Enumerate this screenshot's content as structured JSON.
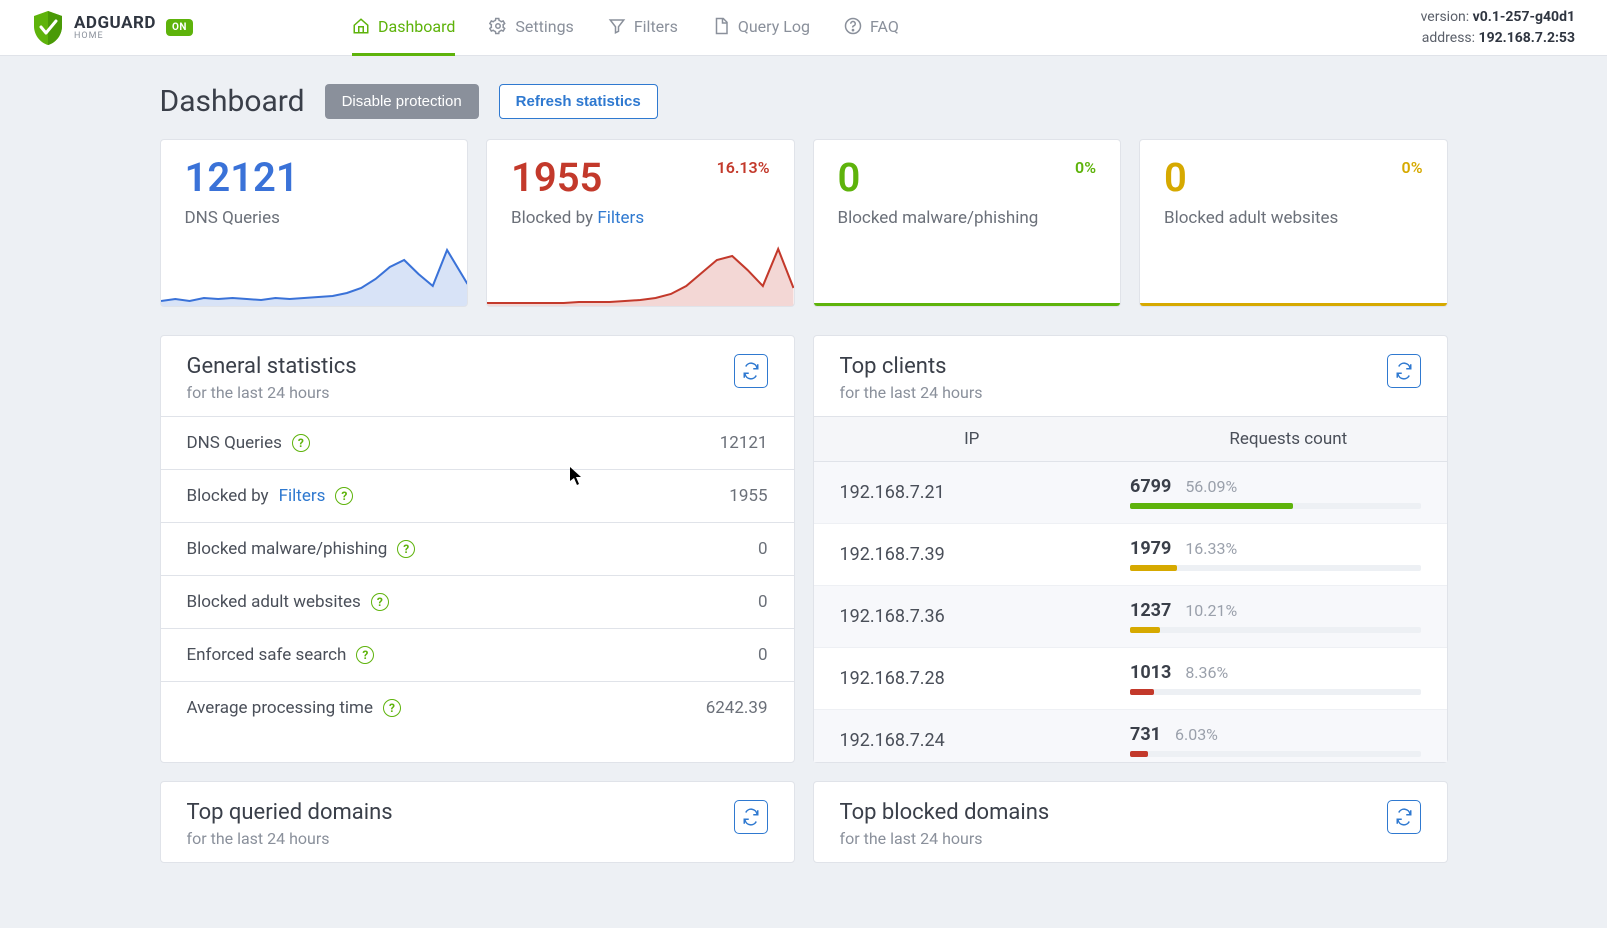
{
  "brand": {
    "name": "ADGUARD",
    "sub": "HOME",
    "status_badge": "ON"
  },
  "nav": {
    "items": [
      {
        "label": "Dashboard",
        "icon": "home-icon",
        "active": true
      },
      {
        "label": "Settings",
        "icon": "gear-icon"
      },
      {
        "label": "Filters",
        "icon": "funnel-icon"
      },
      {
        "label": "Query Log",
        "icon": "doc-icon"
      },
      {
        "label": "FAQ",
        "icon": "help-icon"
      }
    ],
    "version_label": "version:",
    "version_value": "v0.1-257-g40d1",
    "address_label": "address:",
    "address_value": "192.168.7.2:53"
  },
  "header": {
    "title": "Dashboard",
    "disable_btn": "Disable protection",
    "refresh_btn": "Refresh statistics"
  },
  "stat_cards": [
    {
      "value": "12121",
      "label_pre": "DNS Queries",
      "label_link": "",
      "pct": "",
      "color": "blue",
      "has_spark": true
    },
    {
      "value": "1955",
      "label_pre": "Blocked by ",
      "label_link": "Filters",
      "pct": "16.13%",
      "color": "red",
      "has_spark": true
    },
    {
      "value": "0",
      "label_pre": "Blocked malware/phishing",
      "label_link": "",
      "pct": "0%",
      "color": "green",
      "has_spark": false
    },
    {
      "value": "0",
      "label_pre": "Blocked adult websites",
      "label_link": "",
      "pct": "0%",
      "color": "yellow",
      "has_spark": false
    }
  ],
  "general_stats": {
    "title": "General statistics",
    "subtitle": "for the last 24 hours",
    "rows": [
      {
        "label_pre": "DNS Queries",
        "label_link": "",
        "value": "12121"
      },
      {
        "label_pre": "Blocked by ",
        "label_link": "Filters",
        "value": "1955"
      },
      {
        "label_pre": "Blocked malware/phishing",
        "label_link": "",
        "value": "0"
      },
      {
        "label_pre": "Blocked adult websites",
        "label_link": "",
        "value": "0"
      },
      {
        "label_pre": "Enforced safe search",
        "label_link": "",
        "value": "0"
      },
      {
        "label_pre": "Average processing time",
        "label_link": "",
        "value": "6242.39"
      }
    ]
  },
  "top_clients": {
    "title": "Top clients",
    "subtitle": "for the last 24 hours",
    "col_ip": "IP",
    "col_req": "Requests count",
    "rows": [
      {
        "ip": "192.168.7.21",
        "count": "6799",
        "pct": "56.09%",
        "bar_pct": 56.09,
        "bar_color": "#5eb30b"
      },
      {
        "ip": "192.168.7.39",
        "count": "1979",
        "pct": "16.33%",
        "bar_pct": 16.33,
        "bar_color": "#d6a900"
      },
      {
        "ip": "192.168.7.36",
        "count": "1237",
        "pct": "10.21%",
        "bar_pct": 10.21,
        "bar_color": "#d6a900"
      },
      {
        "ip": "192.168.7.28",
        "count": "1013",
        "pct": "8.36%",
        "bar_pct": 8.36,
        "bar_color": "#c3392b"
      },
      {
        "ip": "192.168.7.24",
        "count": "731",
        "pct": "6.03%",
        "bar_pct": 6.03,
        "bar_color": "#c3392b"
      }
    ]
  },
  "top_queried": {
    "title": "Top queried domains",
    "subtitle": "for the last 24 hours"
  },
  "top_blocked": {
    "title": "Top blocked domains",
    "subtitle": "for the last 24 hours"
  },
  "chart_data": [
    {
      "type": "line",
      "title": "DNS Queries",
      "series": [
        {
          "name": "dns",
          "values": [
            4,
            5,
            4,
            5,
            6,
            5,
            5,
            4,
            6,
            5,
            5,
            6,
            8,
            12,
            20,
            34,
            52,
            58,
            40,
            24,
            86,
            30
          ]
        }
      ]
    },
    {
      "type": "line",
      "title": "Blocked by Filters",
      "series": [
        {
          "name": "blocked",
          "values": [
            2,
            2,
            2,
            2,
            2,
            2,
            2,
            3,
            3,
            3,
            4,
            5,
            8,
            16,
            28,
            40,
            48,
            36,
            20,
            64,
            18
          ]
        }
      ]
    }
  ],
  "colors": {
    "blue": "#3a72d8",
    "red": "#c3392b",
    "green": "#5eb30b",
    "yellow": "#d6a900",
    "link": "#2f79d0"
  }
}
